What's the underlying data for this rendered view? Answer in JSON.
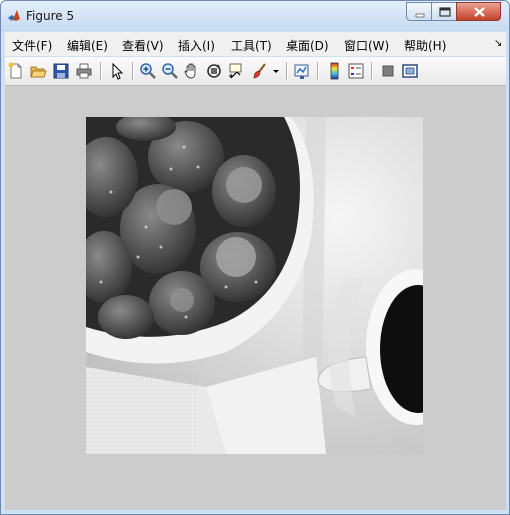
{
  "window": {
    "title": "Figure 5"
  },
  "menu": [
    {
      "label": "文件(F)"
    },
    {
      "label": "编辑(E)"
    },
    {
      "label": "查看(V)"
    },
    {
      "label": "插入(I)"
    },
    {
      "label": "工具(T)"
    },
    {
      "label": "桌面(D)"
    },
    {
      "label": "窗口(W)"
    },
    {
      "label": "帮助(H)"
    }
  ],
  "menu_overflow_icon": "dock-arrow-icon",
  "toolbar": [
    {
      "icon": "new-figure-icon"
    },
    {
      "icon": "open-file-icon"
    },
    {
      "icon": "save-icon"
    },
    {
      "icon": "print-icon"
    },
    {
      "icon": "edit-plot-arrow-icon"
    },
    {
      "icon": "zoom-in-icon"
    },
    {
      "icon": "zoom-out-icon"
    },
    {
      "icon": "pan-hand-icon"
    },
    {
      "icon": "rotate-3d-icon"
    },
    {
      "icon": "data-cursor-icon"
    },
    {
      "icon": "brush-icon"
    },
    {
      "icon": "link-plot-icon"
    },
    {
      "icon": "colorbar-icon"
    },
    {
      "icon": "legend-icon"
    },
    {
      "icon": "hide-plot-tools-icon"
    },
    {
      "icon": "show-plot-tools-icon"
    }
  ],
  "figure": {
    "image_description_icon": "grayscale-photo-strawberries-coffee",
    "background": "#cccccc"
  },
  "colors": {
    "title_bar": "#c6daf0",
    "close_button": "#c3402a",
    "menubar": "#f0f0f0"
  }
}
